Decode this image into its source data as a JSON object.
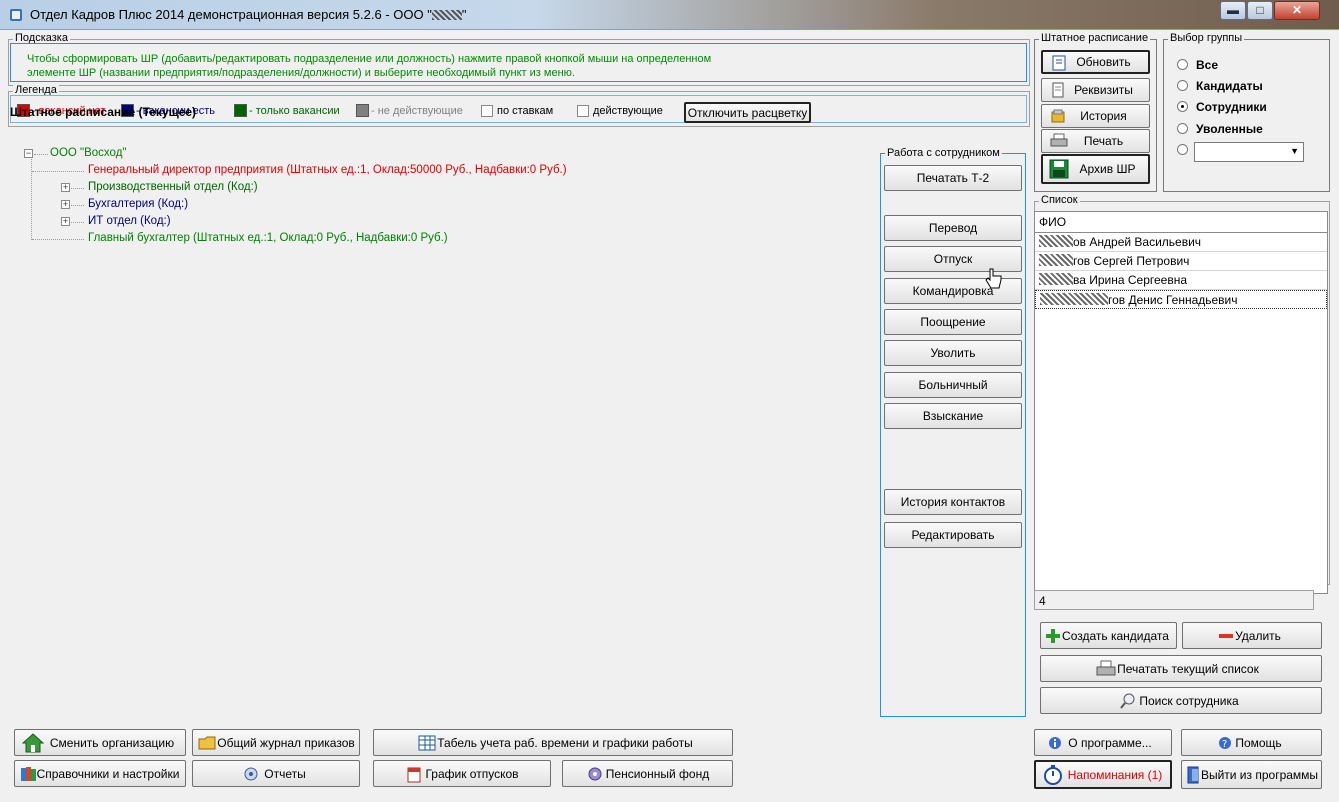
{
  "window": {
    "title": "Отдел Кадров Плюс 2014 демонстрационная версия 5.2.6 - ООО \"",
    "title_tail": "\"",
    "minimize": "▬",
    "maximize": "□",
    "close": "✕"
  },
  "hint": {
    "label": "Подсказка",
    "line1": "Чтобы сформировать ШР (добавить/редактировать подразделение или должность) нажмите правой кнопкой мыши на определенном",
    "line2": "элементе ШР (названии предприятия/подразделения/должности) и выберите необходимый пункт из меню."
  },
  "legend": {
    "label": "Легенда",
    "items": [
      {
        "color": "#e00000",
        "text": "- вакансий нет",
        "text_color": "#e00000"
      },
      {
        "color": "#000080",
        "text": "- вакансии есть",
        "text_color": "#000080"
      },
      {
        "color": "#006400",
        "text": "- только вакансии",
        "text_color": "#006400"
      },
      {
        "color": "#808080",
        "text": "- не действующие",
        "text_color": "#808080"
      }
    ],
    "check_by_rate": "по ставкам",
    "check_active": "действующие",
    "disable_colors_button": "Отключить расцветку"
  },
  "staff_panel": {
    "label": "Штатное расписание",
    "refresh": "Обновить",
    "requisites": "Реквизиты",
    "history": "История",
    "print": "Печать",
    "archive": "Архив ШР"
  },
  "group_select": {
    "label": "Выбор группы",
    "options": [
      "Все",
      "Кандидаты",
      "Сотрудники",
      "Уволенные"
    ],
    "selected": "Сотрудники",
    "combo_value": ""
  },
  "tree": {
    "title": "Штатное расписание (Текущее)",
    "root": "ООО \"Восход\"",
    "items": [
      {
        "text": "Генеральный директор предприятия (Штатных ед.:1, Оклад:50000 Руб., Надбавки:0 Руб.)",
        "color": "#e00000",
        "expandable": false
      },
      {
        "text": "Производственный отдел (Код:)",
        "color": "#006400",
        "expandable": true
      },
      {
        "text": "Бухгалтерия (Код:)",
        "color": "#000080",
        "expandable": true
      },
      {
        "text": "ИТ отдел (Код:)",
        "color": "#000080",
        "expandable": true
      },
      {
        "text": "Главный бухгалтер (Штатных ед.:1, Оклад:0 Руб., Надбавки:0 Руб.)",
        "color": "#008000",
        "expandable": false
      }
    ]
  },
  "employee_work": {
    "label": "Работа с сотрудником",
    "print_t2": "Печатать Т-2",
    "transfer": "Перевод",
    "vacation": "Отпуск",
    "business_trip": "Командировка",
    "bonus": "Поощрение",
    "dismiss": "Уволить",
    "sick_leave": "Больничный",
    "penalty": "Взыскание",
    "contact_history": "История контактов",
    "edit": "Редактировать"
  },
  "list": {
    "label": "Список",
    "header": "ФИО",
    "rows": [
      {
        "visible": "ов Андрей Васильевич"
      },
      {
        "visible": "гов Сергей Петрович"
      },
      {
        "visible": "ва Ирина Сергеевна"
      },
      {
        "visible": "гов Денис Геннадьевич"
      }
    ],
    "count": "4"
  },
  "list_actions": {
    "create_candidate": "Создать кандидата",
    "delete": "Удалить",
    "print_list": "Печатать текущий список",
    "search_employee": "Поиск сотрудника"
  },
  "bottom": {
    "change_org": "Сменить организацию",
    "orders_journal": "Общий журнал приказов",
    "timesheet": "Табель учета раб. времени и графики работы",
    "about": "О программе...",
    "help": "Помощь",
    "references": "Справочники и настройки",
    "reports": "Отчеты",
    "vacation_schedule": "График отпусков",
    "pension_fund": "Пенсионный фонд",
    "reminders": "Напоминания (1)",
    "exit": "Выйти из программы"
  },
  "colors": {
    "reminder_text": "#e00000",
    "tree_root": "#008000"
  }
}
